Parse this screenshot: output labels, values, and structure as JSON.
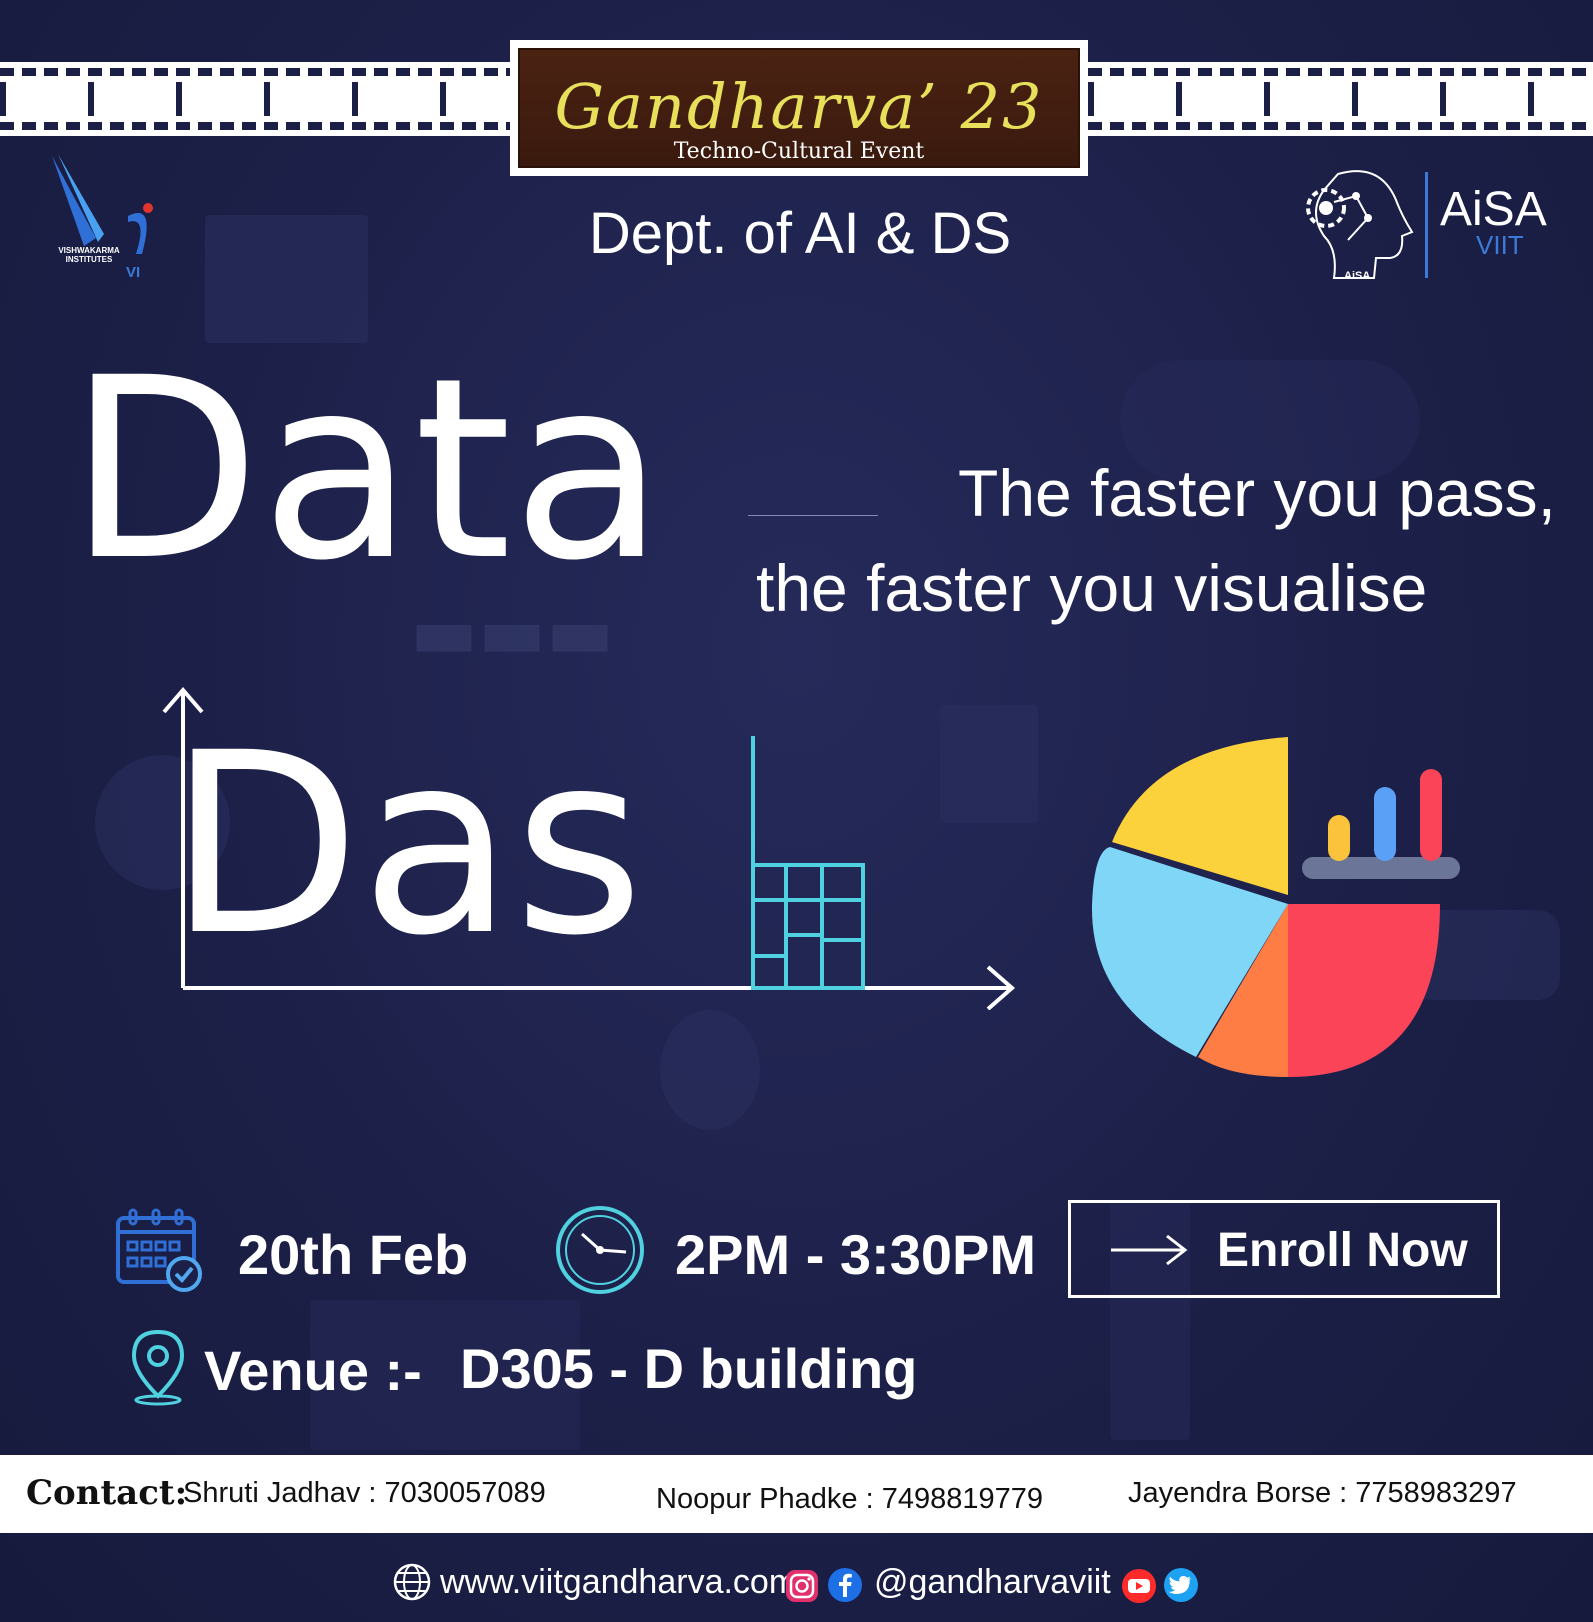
{
  "header": {
    "event_title": "Gandharva’ 23",
    "event_subtitle": "Techno-Cultural Event",
    "department": "Dept. of AI & DS"
  },
  "logos": {
    "left_org_text": "VISHWAKARMA INSTITUTES",
    "left_mark": "VI",
    "right_org_name": "AiSA",
    "right_org_sub": "VIIT",
    "right_badge": "AiSA"
  },
  "headline": {
    "word1": "Data",
    "word2": "Das"
  },
  "tagline": {
    "line1": "The faster you pass,",
    "line2": "the faster you visualise"
  },
  "details": {
    "date": "20th Feb",
    "time": "2PM - 3:30PM",
    "venue_label": "Venue :-",
    "venue_value": "D305 - D building"
  },
  "cta": {
    "label": "Enroll Now"
  },
  "contact": {
    "label": "Contact:",
    "people": [
      {
        "text": "Shruti Jadhav : 7030057089"
      },
      {
        "text": "Noopur Phadke : 7498819779"
      },
      {
        "text": "Jayendra Borse : 7758983297"
      }
    ]
  },
  "footer": {
    "website": "www.viitgandharva.com",
    "handle": "@gandharvaviit"
  },
  "colors": {
    "background": "#1c2048",
    "title_gold": "#e8e05a",
    "title_brown": "#3a1a0e",
    "pie_yellow": "#fbd13c",
    "pie_red": "#fb4458",
    "pie_orange": "#fd7d45",
    "pie_blue": "#7fd6f6",
    "bar_blue": "#5ba0f7",
    "accent_cyan": "#4fd1e0"
  },
  "icons": {
    "calendar": "calendar-check-icon",
    "clock": "clock-icon",
    "location": "location-pin-icon",
    "arrow": "arrow-right-icon",
    "globe": "globe-icon",
    "instagram": "instagram-icon",
    "facebook": "facebook-icon",
    "youtube": "youtube-icon",
    "twitter": "twitter-icon"
  }
}
